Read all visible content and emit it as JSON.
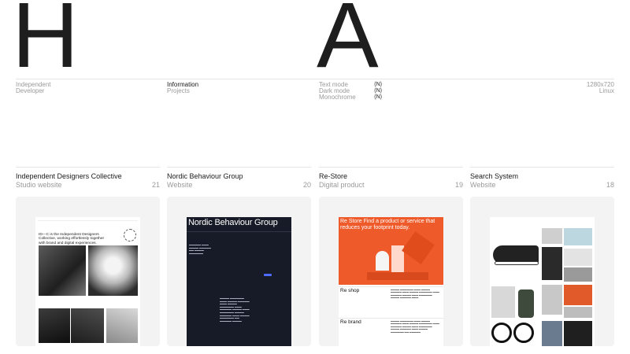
{
  "hero": {
    "letter_left": "H",
    "letter_right": "A"
  },
  "meta": {
    "col1": {
      "line1": "Independent",
      "line2": "Developer"
    },
    "col2": {
      "line1": "Information",
      "line2": "Projects"
    },
    "modes": [
      {
        "label": "Text mode",
        "key": "(N)"
      },
      {
        "label": "Dark mode",
        "key": "(N)"
      },
      {
        "label": "Monochrome",
        "key": "(N)"
      }
    ],
    "col4": {
      "line1": "1280x720",
      "line2": "Linux"
    }
  },
  "projects": [
    {
      "title": "Independent Designers Collective",
      "type": "Studio website",
      "number": "21"
    },
    {
      "title": "Nordic Behaviour Group",
      "type": "Website",
      "number": "20"
    },
    {
      "title": "Re-Store",
      "type": "Digital product",
      "number": "19"
    },
    {
      "title": "Search System",
      "type": "Website",
      "number": "18"
    }
  ],
  "preview_idc": {
    "intro": "ID—C is the Independent Designers Collective, working effortlessly together with brand and digital experiences."
  },
  "preview_nbg": {
    "brand": "Nordic Behaviour Group"
  },
  "preview_restore": {
    "hero_text": "Re Store Find a product or service that reduces your footprint today.",
    "section1": "Re shop",
    "section2": "Re brand"
  },
  "colors": {
    "card_bg": "#f3f3f3",
    "nbg_bg": "#171a27",
    "restore_orange": "#ef5a2a",
    "muted_text": "#9a9a9a"
  }
}
